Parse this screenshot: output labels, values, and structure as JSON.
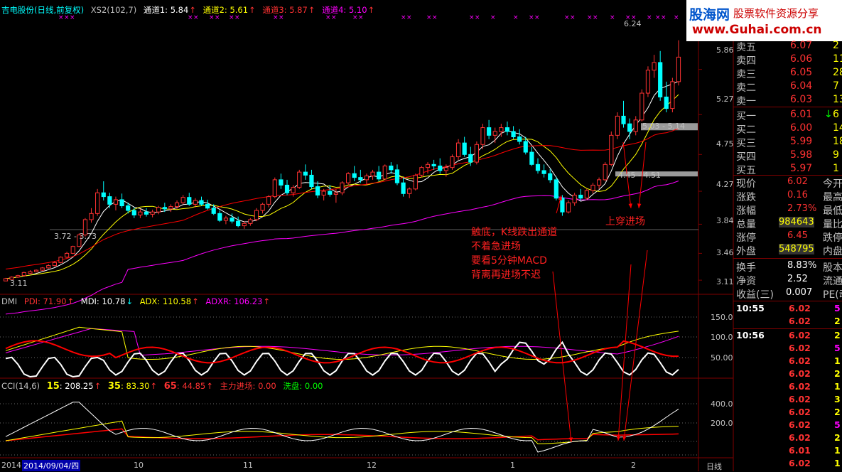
{
  "colors": {
    "up": "#ff3232",
    "down": "#00ffff",
    "white": "#ffffff",
    "yellow": "#ffff00",
    "magenta": "#ff00ff",
    "grid": "#800000",
    "red": "#ff0000",
    "green": "#00ff00",
    "gray": "#c0c0c0"
  },
  "header": {
    "stock": "吉电股份",
    "period": "(日线,前复权)",
    "indicator": "XS2(102,7)",
    "ch1": "通道1: 5.84",
    "ch2": "通道2: 5.61",
    "ch3": "通道3: 5.87",
    "ch4": "通道4: 5.10"
  },
  "logo": {
    "main": "股海网",
    "tag": "股票软件资源分享",
    "url": "www.Guhai.com.cn"
  },
  "price_axis": [
    "5.86",
    "5.27",
    "4.75",
    "4.27",
    "3.84",
    "3.46",
    "3.11"
  ],
  "price_labels": {
    "high": "6.24",
    "low": "3.11",
    "zone1": "5.03 - 5.14",
    "zone2": "4.45 - 4.51",
    "zone3": "3.72 - 3.73"
  },
  "annotations": {
    "note1": [
      "触底，K线跌出通道",
      "不着急进场",
      "要看5分钟MACD",
      "背离再进场不迟"
    ],
    "note2": "上穿进场"
  },
  "dmi": {
    "name": "DMI",
    "pdi": "PDI: 71.90",
    "mdi": "MDI: 10.78",
    "adx": "ADX: 110.58",
    "adxr": "ADXR: 106.23",
    "axis": [
      "150.0",
      "100.0",
      "50.00"
    ]
  },
  "cci": {
    "name": "CCI(14,6)",
    "v15_key": "15",
    "v15": ": 208.25",
    "v35_key": "35",
    "v35": ": 83.30",
    "v65_key": "65",
    "v65": ": 44.85",
    "main": "主力进场: 0.00",
    "wash": "洗盘: 0.00",
    "axis": [
      "400.0",
      "200.0"
    ]
  },
  "date_axis": {
    "start": "2014",
    "cursor": "2014/09/04/四",
    "months": [
      "10",
      "11",
      "12",
      "1",
      "2"
    ],
    "period": "日线"
  },
  "orderbook": {
    "sells": [
      {
        "l": "卖五",
        "p": "6.07",
        "v": "2"
      },
      {
        "l": "卖四",
        "p": "6.06",
        "v": "11"
      },
      {
        "l": "卖三",
        "p": "6.05",
        "v": "28"
      },
      {
        "l": "卖二",
        "p": "6.04",
        "v": "7"
      },
      {
        "l": "卖一",
        "p": "6.03",
        "v": "13"
      }
    ],
    "buys": [
      {
        "l": "买一",
        "p": "6.01",
        "v": "6"
      },
      {
        "l": "买二",
        "p": "6.00",
        "v": "14"
      },
      {
        "l": "买三",
        "p": "5.99",
        "v": "18"
      },
      {
        "l": "买四",
        "p": "5.98",
        "v": "9"
      },
      {
        "l": "买五",
        "p": "5.97",
        "v": "1"
      }
    ]
  },
  "quote": [
    {
      "l": "现价",
      "v": "6.02",
      "l2": "今开"
    },
    {
      "l": "涨跌",
      "v": "0.16",
      "l2": "最高"
    },
    {
      "l": "涨幅",
      "v": "2.73%",
      "l2": "最低"
    },
    {
      "l": "总量",
      "v": "984643",
      "l2": "量比"
    },
    {
      "l": "涨停",
      "v": "6.45",
      "l2": "跌停"
    },
    {
      "l": "外盘",
      "v": "548795",
      "l2": "内盘"
    },
    {
      "l": "换手",
      "v": "8.83%",
      "l2": "股本"
    },
    {
      "l": "净资",
      "v": "2.52",
      "l2": "流通"
    },
    {
      "l": "收益(三)",
      "v": "0.007",
      "l2": "PE(动)"
    }
  ],
  "ticks": [
    {
      "t": "10:55",
      "p": "6.02",
      "v": "5"
    },
    {
      "t": "",
      "p": "6.02",
      "v": "2"
    },
    {
      "t": "10:56",
      "p": "6.02",
      "v": "2"
    },
    {
      "t": "",
      "p": "6.02",
      "v": "5"
    },
    {
      "t": "",
      "p": "6.02",
      "v": "1"
    },
    {
      "t": "",
      "p": "6.02",
      "v": "2"
    },
    {
      "t": "",
      "p": "6.02",
      "v": "1"
    },
    {
      "t": "",
      "p": "6.02",
      "v": "3"
    },
    {
      "t": "",
      "p": "6.02",
      "v": "2"
    },
    {
      "t": "",
      "p": "6.02",
      "v": "5"
    },
    {
      "t": "",
      "p": "6.02",
      "v": "2"
    },
    {
      "t": "",
      "p": "6.01",
      "v": "1"
    },
    {
      "t": "",
      "p": "6.02",
      "v": "1"
    }
  ],
  "chart_data": {
    "type": "candlestick",
    "price_ylim": [
      3.0,
      6.45
    ],
    "candles": [
      [
        3.1,
        3.14,
        3.1,
        3.13
      ],
      [
        3.12,
        3.16,
        3.12,
        3.15
      ],
      [
        3.15,
        3.18,
        3.14,
        3.17
      ],
      [
        3.17,
        3.22,
        3.16,
        3.21
      ],
      [
        3.2,
        3.24,
        3.19,
        3.22
      ],
      [
        3.22,
        3.25,
        3.21,
        3.24
      ],
      [
        3.24,
        3.28,
        3.23,
        3.27
      ],
      [
        3.27,
        3.32,
        3.26,
        3.3
      ],
      [
        3.3,
        3.36,
        3.29,
        3.34
      ],
      [
        3.34,
        3.42,
        3.33,
        3.41
      ],
      [
        3.41,
        3.48,
        3.4,
        3.46
      ],
      [
        3.46,
        3.56,
        3.45,
        3.55
      ],
      [
        3.55,
        3.72,
        3.54,
        3.7
      ],
      [
        3.7,
        3.92,
        3.68,
        3.9
      ],
      [
        3.9,
        4.05,
        3.86,
        3.98
      ],
      [
        3.98,
        4.3,
        3.95,
        4.25
      ],
      [
        4.25,
        4.4,
        4.15,
        4.2
      ],
      [
        4.2,
        4.25,
        4.05,
        4.1
      ],
      [
        4.1,
        4.2,
        4.02,
        4.16
      ],
      [
        4.16,
        4.24,
        4.05,
        4.08
      ],
      [
        4.08,
        4.12,
        3.98,
        4.02
      ],
      [
        4.02,
        4.06,
        3.92,
        3.96
      ],
      [
        3.96,
        4.04,
        3.92,
        4.0
      ],
      [
        4.0,
        4.05,
        3.94,
        3.97
      ],
      [
        3.97,
        4.03,
        3.93,
        4.0
      ],
      [
        4.0,
        4.08,
        3.97,
        4.06
      ],
      [
        4.06,
        4.12,
        4.0,
        4.04
      ],
      [
        4.04,
        4.1,
        4.0,
        4.07
      ],
      [
        4.07,
        4.15,
        4.04,
        4.12
      ],
      [
        4.12,
        4.22,
        4.1,
        4.19
      ],
      [
        4.19,
        4.25,
        4.08,
        4.1
      ],
      [
        4.1,
        4.18,
        4.06,
        4.15
      ],
      [
        4.15,
        4.2,
        4.08,
        4.1
      ],
      [
        4.1,
        4.16,
        4.03,
        4.05
      ],
      [
        4.05,
        4.1,
        3.96,
        3.98
      ],
      [
        3.98,
        4.02,
        3.87,
        3.89
      ],
      [
        3.89,
        3.95,
        3.84,
        3.92
      ],
      [
        3.92,
        3.98,
        3.85,
        3.88
      ],
      [
        3.88,
        3.94,
        3.8,
        3.82
      ],
      [
        3.82,
        3.88,
        3.78,
        3.85
      ],
      [
        3.85,
        3.92,
        3.82,
        3.9
      ],
      [
        3.9,
        4.05,
        3.88,
        4.02
      ],
      [
        4.02,
        4.12,
        3.98,
        4.1
      ],
      [
        4.1,
        4.22,
        4.06,
        4.2
      ],
      [
        4.2,
        4.45,
        4.18,
        4.42
      ],
      [
        4.42,
        4.5,
        4.3,
        4.35
      ],
      [
        4.35,
        4.42,
        4.22,
        4.25
      ],
      [
        4.25,
        4.35,
        4.2,
        4.32
      ],
      [
        4.32,
        4.55,
        4.3,
        4.52
      ],
      [
        4.52,
        4.62,
        4.42,
        4.48
      ],
      [
        4.48,
        4.55,
        4.3,
        4.33
      ],
      [
        4.33,
        4.4,
        4.18,
        4.22
      ],
      [
        4.22,
        4.3,
        4.15,
        4.27
      ],
      [
        4.27,
        4.35,
        4.2,
        4.23
      ],
      [
        4.23,
        4.3,
        4.12,
        4.25
      ],
      [
        4.25,
        4.4,
        4.22,
        4.38
      ],
      [
        4.38,
        4.52,
        4.35,
        4.5
      ],
      [
        4.5,
        4.6,
        4.4,
        4.45
      ],
      [
        4.45,
        4.55,
        4.38,
        4.42
      ],
      [
        4.42,
        4.5,
        4.35,
        4.47
      ],
      [
        4.47,
        4.55,
        4.42,
        4.52
      ],
      [
        4.52,
        4.6,
        4.4,
        4.43
      ],
      [
        4.43,
        4.62,
        4.42,
        4.6
      ],
      [
        4.6,
        4.65,
        4.5,
        4.55
      ],
      [
        4.55,
        4.62,
        4.35,
        4.38
      ],
      [
        4.38,
        4.45,
        4.2,
        4.24
      ],
      [
        4.24,
        4.32,
        4.18,
        4.3
      ],
      [
        4.3,
        4.5,
        4.28,
        4.48
      ],
      [
        4.48,
        4.6,
        4.45,
        4.58
      ],
      [
        4.58,
        4.65,
        4.5,
        4.62
      ],
      [
        4.62,
        4.68,
        4.55,
        4.6
      ],
      [
        4.6,
        4.7,
        4.5,
        4.54
      ],
      [
        4.54,
        4.62,
        4.46,
        4.58
      ],
      [
        4.58,
        4.75,
        4.55,
        4.72
      ],
      [
        4.72,
        4.95,
        4.68,
        4.9
      ],
      [
        4.9,
        4.98,
        4.72,
        4.75
      ],
      [
        4.75,
        4.85,
        4.6,
        4.65
      ],
      [
        4.65,
        4.92,
        4.62,
        4.88
      ],
      [
        4.88,
        5.15,
        4.82,
        5.1
      ],
      [
        5.1,
        5.2,
        4.95,
        5.0
      ],
      [
        5.0,
        5.1,
        4.9,
        5.05
      ],
      [
        5.05,
        5.15,
        4.98,
        5.1
      ],
      [
        5.1,
        5.18,
        5.0,
        5.05
      ],
      [
        5.05,
        5.12,
        4.95,
        4.98
      ],
      [
        4.98,
        5.08,
        4.88,
        4.92
      ],
      [
        4.92,
        4.98,
        4.75,
        4.78
      ],
      [
        4.78,
        4.85,
        4.6,
        4.62
      ],
      [
        4.62,
        4.7,
        4.5,
        4.54
      ],
      [
        4.54,
        4.62,
        4.45,
        4.5
      ],
      [
        4.5,
        4.56,
        4.38,
        4.42
      ],
      [
        4.42,
        4.46,
        4.15,
        4.18
      ],
      [
        4.18,
        4.22,
        3.95,
        4.0
      ],
      [
        4.0,
        4.15,
        3.98,
        4.12
      ],
      [
        4.12,
        4.25,
        4.08,
        4.22
      ],
      [
        4.22,
        4.3,
        4.15,
        4.18
      ],
      [
        4.18,
        4.3,
        4.16,
        4.28
      ],
      [
        4.28,
        4.38,
        4.24,
        4.35
      ],
      [
        4.35,
        4.45,
        4.3,
        4.42
      ],
      [
        4.42,
        4.65,
        4.4,
        4.62
      ],
      [
        4.62,
        5.05,
        4.6,
        5.0
      ],
      [
        5.0,
        5.3,
        4.95,
        5.25
      ],
      [
        5.25,
        5.45,
        5.1,
        5.15
      ],
      [
        5.15,
        5.22,
        4.95,
        5.05
      ],
      [
        5.05,
        5.25,
        5.0,
        5.2
      ],
      [
        5.2,
        5.6,
        5.18,
        5.55
      ],
      [
        5.55,
        5.9,
        5.5,
        5.85
      ],
      [
        5.85,
        6.05,
        5.75,
        5.95
      ],
      [
        5.95,
        6.1,
        5.45,
        5.5
      ],
      [
        5.5,
        5.7,
        5.3,
        5.35
      ],
      [
        5.35,
        5.75,
        5.3,
        5.7
      ],
      [
        5.7,
        6.24,
        5.65,
        6.02
      ]
    ],
    "dmi_ylim": [
      0,
      180
    ],
    "cci_ylim": [
      -150,
      560
    ]
  }
}
